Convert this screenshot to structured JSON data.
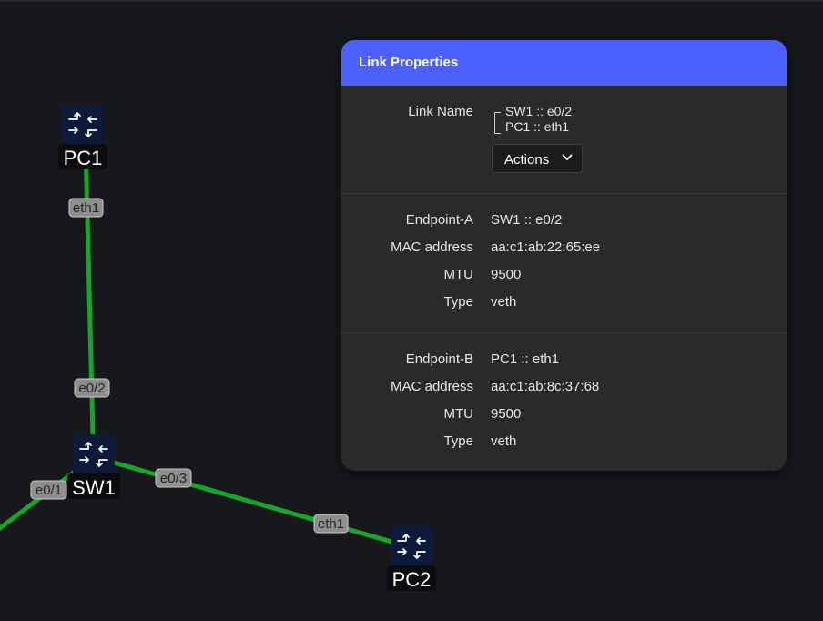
{
  "topology": {
    "nodes": [
      {
        "id": "PC1",
        "label": "PC1"
      },
      {
        "id": "SW1",
        "label": "SW1"
      },
      {
        "id": "PC2",
        "label": "PC2"
      }
    ],
    "ports": {
      "pc1_eth1": "eth1",
      "sw1_e0_2": "e0/2",
      "sw1_e0_1": "e0/1",
      "sw1_e0_3": "e0/3",
      "pc2_eth1": "eth1"
    },
    "link_color": "#18a52d",
    "node_color": "#0d1a3a",
    "node_icon": "router-arrows-icon"
  },
  "panel": {
    "title": "Link Properties",
    "accent": "#4c60ff",
    "link_name_label": "Link Name",
    "link_name_a": "SW1 :: e0/2",
    "link_name_b": "PC1 :: eth1",
    "actions_label": "Actions",
    "endpoint_a": {
      "title_label": "Endpoint-A",
      "title_value": "SW1 :: e0/2",
      "mac_label": "MAC address",
      "mac_value": "aa:c1:ab:22:65:ee",
      "mtu_label": "MTU",
      "mtu_value": "9500",
      "type_label": "Type",
      "type_value": "veth"
    },
    "endpoint_b": {
      "title_label": "Endpoint-B",
      "title_value": "PC1 :: eth1",
      "mac_label": "MAC address",
      "mac_value": "aa:c1:ab:8c:37:68",
      "mtu_label": "MTU",
      "mtu_value": "9500",
      "type_label": "Type",
      "type_value": "veth"
    }
  }
}
